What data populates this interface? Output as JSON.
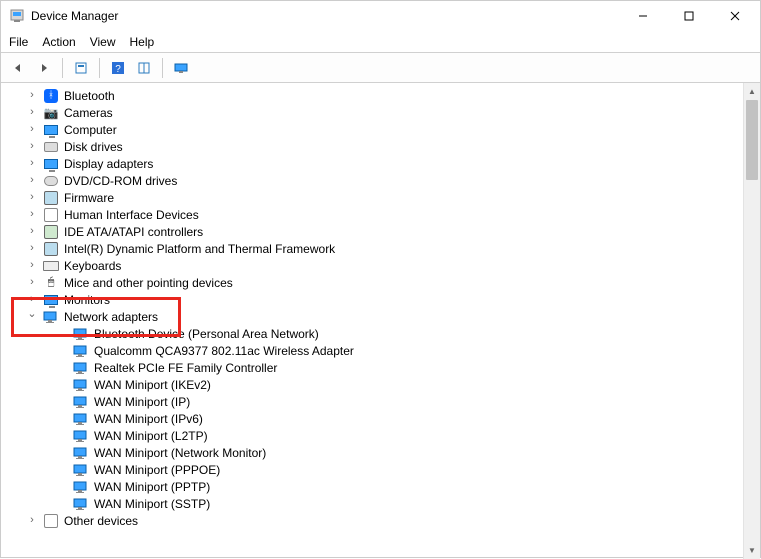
{
  "window": {
    "title": "Device Manager"
  },
  "menu": {
    "file": "File",
    "action": "Action",
    "view": "View",
    "help": "Help"
  },
  "tree": {
    "categories": [
      {
        "id": "bluetooth",
        "label": "Bluetooth",
        "expanded": false
      },
      {
        "id": "cameras",
        "label": "Cameras",
        "expanded": false
      },
      {
        "id": "computer",
        "label": "Computer",
        "expanded": false
      },
      {
        "id": "disk-drives",
        "label": "Disk drives",
        "expanded": false
      },
      {
        "id": "display-adapters",
        "label": "Display adapters",
        "expanded": false
      },
      {
        "id": "dvd-cdrom",
        "label": "DVD/CD-ROM drives",
        "expanded": false
      },
      {
        "id": "firmware",
        "label": "Firmware",
        "expanded": false
      },
      {
        "id": "hid",
        "label": "Human Interface Devices",
        "expanded": false
      },
      {
        "id": "ide-atapi",
        "label": "IDE ATA/ATAPI controllers",
        "expanded": false
      },
      {
        "id": "intel-dptf",
        "label": "Intel(R) Dynamic Platform and Thermal Framework",
        "expanded": false
      },
      {
        "id": "keyboards",
        "label": "Keyboards",
        "expanded": false
      },
      {
        "id": "mice",
        "label": "Mice and other pointing devices",
        "expanded": false
      },
      {
        "id": "monitors",
        "label": "Monitors",
        "expanded": false
      },
      {
        "id": "network-adapters",
        "label": "Network adapters",
        "expanded": true,
        "children": [
          {
            "label": "Bluetooth Device (Personal Area Network)"
          },
          {
            "label": "Qualcomm QCA9377 802.11ac Wireless Adapter"
          },
          {
            "label": "Realtek PCIe FE Family Controller"
          },
          {
            "label": "WAN Miniport (IKEv2)"
          },
          {
            "label": "WAN Miniport (IP)"
          },
          {
            "label": "WAN Miniport (IPv6)"
          },
          {
            "label": "WAN Miniport (L2TP)"
          },
          {
            "label": "WAN Miniport (Network Monitor)"
          },
          {
            "label": "WAN Miniport (PPPOE)"
          },
          {
            "label": "WAN Miniport (PPTP)"
          },
          {
            "label": "WAN Miniport (SSTP)"
          }
        ]
      },
      {
        "id": "other-devices",
        "label": "Other devices",
        "expanded": false
      }
    ]
  },
  "highlight": {
    "category_id": "network-adapters"
  }
}
